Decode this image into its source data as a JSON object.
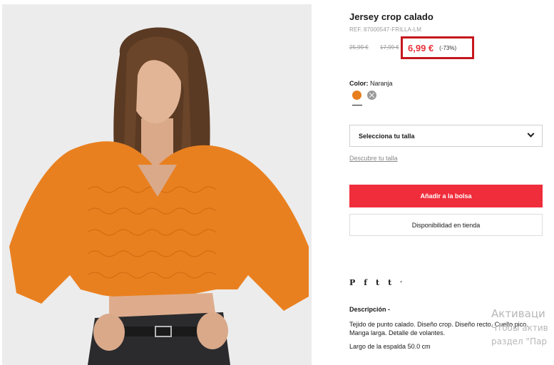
{
  "product": {
    "title": "Jersey crop calado",
    "ref": "REF. 87000547-FRILLA-LM",
    "old_price_1": "25,99 €",
    "old_price_2": "17,99 €",
    "current_price": "6,99 €",
    "discount": "(-73%)"
  },
  "color": {
    "label": "Color:",
    "value": "Naranja",
    "swatches": [
      "#e87d1e",
      "#9a9a9a"
    ],
    "swatch_names": [
      "orange-swatch",
      "grey-swatch-unavailable"
    ]
  },
  "size": {
    "select_label": "Selecciona tu talla",
    "help_link": "Descubre tu talla"
  },
  "actions": {
    "add_to_bag": "Añadir a la bolsa",
    "store_availability": "Disponibilidad en tienda"
  },
  "share": {
    "icons": [
      "pinterest-icon",
      "facebook-icon",
      "twitter-icon",
      "tumblr-icon",
      "more-icon"
    ],
    "glyphs": [
      "P",
      "f",
      "t",
      "t",
      "'"
    ]
  },
  "description": {
    "title": "Descripción -",
    "text": "Tejido de punto calado. Diseño crop. Diseño recto. Cuello pico. Manga larga. Detalle de volantes.",
    "measure": "Largo de la espalda 50.0 cm"
  },
  "watermark": {
    "line1": "Активаци",
    "line2": "Чтобы актив",
    "line3": "раздел \"Пар"
  },
  "colors": {
    "accent_red": "#ef2d3b",
    "price_red": "#e8323a",
    "highlight_border": "#c4171d"
  }
}
